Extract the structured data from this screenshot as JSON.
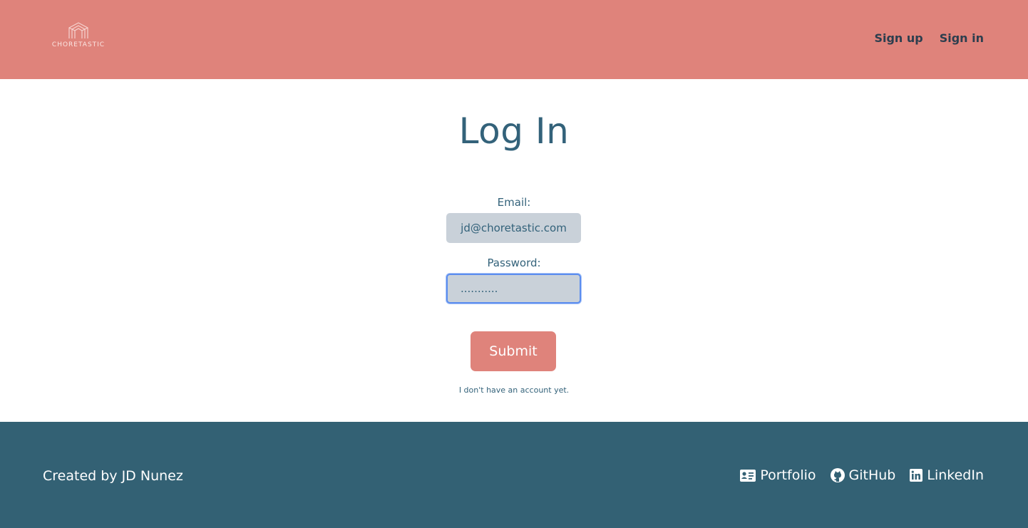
{
  "header": {
    "logo_text": "CHORETASTIC",
    "nav": {
      "signup": "Sign up",
      "signin": "Sign in"
    }
  },
  "main": {
    "title": "Log In",
    "email_label": "Email:",
    "email_value": "jd@choretastic.com",
    "password_label": "Password:",
    "password_value": "...........",
    "submit_label": "Submit",
    "no_account_link": "I don't have an account yet."
  },
  "footer": {
    "credit": "Created by JD Nunez",
    "links": [
      {
        "label": "Portfolio",
        "icon": "id-card-icon"
      },
      {
        "label": "GitHub",
        "icon": "github-icon"
      },
      {
        "label": "LinkedIn",
        "icon": "linkedin-icon"
      }
    ]
  },
  "colors": {
    "header_bg": "#df837b",
    "footer_bg": "#336174",
    "accent_text": "#33627a",
    "input_bg": "#c9d1d9",
    "focus_ring": "#5b8def"
  }
}
